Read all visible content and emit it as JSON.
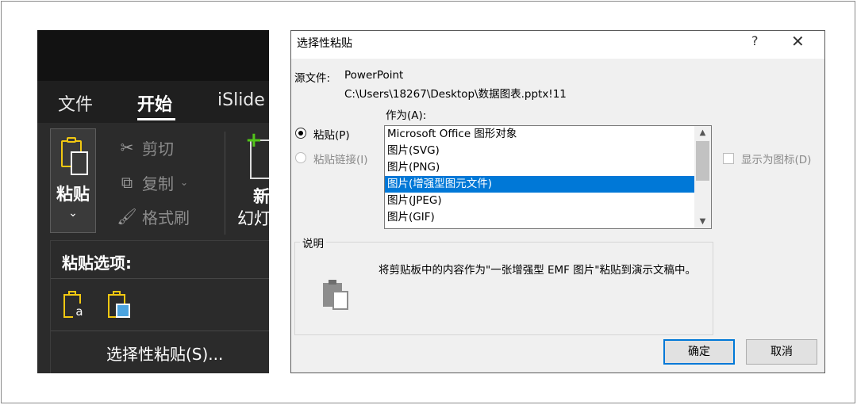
{
  "ribbon": {
    "tabs": [
      "文件",
      "开始",
      "iSlide"
    ],
    "active_tab": "开始",
    "paste": {
      "label": "粘贴",
      "chevron": "⌄"
    },
    "clipboard_commands": [
      {
        "icon": "scissors-icon",
        "glyph": "✂",
        "label": "剪切"
      },
      {
        "icon": "copy-icon",
        "glyph": "⧉",
        "label": "复制",
        "dropdown": "⌄"
      },
      {
        "icon": "format-painter-icon",
        "glyph": "🖌",
        "label": "格式刷"
      }
    ],
    "new_slide": {
      "line1": "新",
      "line2": "幻灯"
    },
    "paste_menu": {
      "header": "粘贴选项:",
      "options": [
        "keep-text-only-icon",
        "picture-icon"
      ],
      "paste_special": "选择性粘贴(S)..."
    }
  },
  "dialog": {
    "title": "选择性粘贴",
    "help": "?",
    "close": "✕",
    "source_label": "源文件:",
    "source_app": "PowerPoint",
    "source_path": "C:\\Users\\18267\\Desktop\\数据图表.pptx!11",
    "as_label": "作为(A):",
    "radio_paste": "粘贴(P)",
    "radio_paste_link": "粘贴链接(I)",
    "list_items": [
      "Microsoft Office 图形对象",
      "图片(SVG)",
      "图片(PNG)",
      "图片(增强型图元文件)",
      "图片(JPEG)",
      "图片(GIF)"
    ],
    "selected_index": 3,
    "display_as_icon": "显示为图标(D)",
    "description_title": "说明",
    "description": "将剪贴板中的内容作为\"一张增强型 EMF 图片\"粘贴到演示文稿中。",
    "ok": "确定",
    "cancel": "取消"
  },
  "colors": {
    "accent": "#0078d7",
    "ribbon_bg": "#2b2b2b",
    "clipboard_yellow": "#f2c811"
  }
}
